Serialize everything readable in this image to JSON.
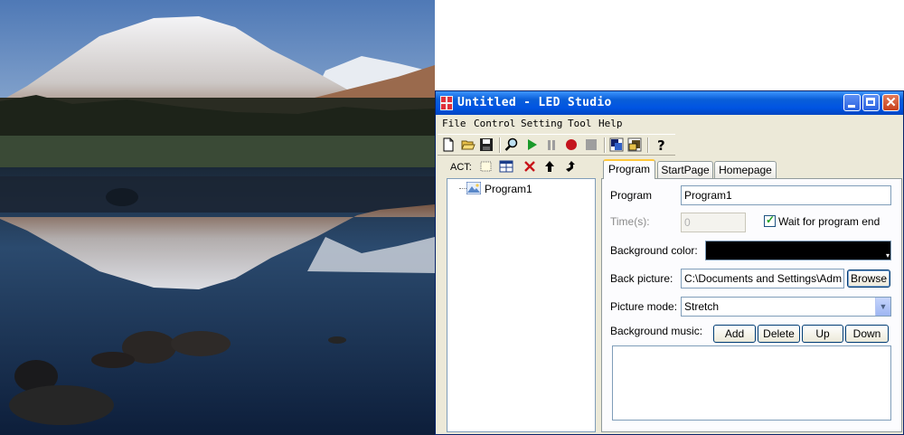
{
  "window": {
    "title": "Untitled - LED Studio"
  },
  "menu": [
    {
      "label": "File"
    },
    {
      "label": "Control"
    },
    {
      "label": "Setting"
    },
    {
      "label": "Tool"
    },
    {
      "label": "Help"
    }
  ],
  "toolbar_icons": [
    "new-file-icon",
    "open-folder-icon",
    "save-icon",
    "search-icon",
    "play-icon",
    "pause-icon",
    "record-icon",
    "stop-icon",
    "window-icon",
    "window-stack-icon",
    "help-icon"
  ],
  "left_panel": {
    "act_label": "ACT:",
    "tree": {
      "items": [
        {
          "label": "Program1"
        }
      ]
    }
  },
  "tabs": [
    {
      "label": "Program",
      "active": true
    },
    {
      "label": "StartPage",
      "active": false
    },
    {
      "label": "Homepage",
      "active": false
    }
  ],
  "form": {
    "program_label": "Program",
    "program_value": "Program1",
    "time_label": "Time(s):",
    "time_value": "0",
    "wait_label": "Wait for program end",
    "wait_checked": true,
    "bgcolor_label": "Background color:",
    "bgcolor_value": "#000000",
    "backpic_label": "Back picture:",
    "backpic_value": "C:\\Documents and Settings\\Adm",
    "browse_label": "Browse",
    "picmode_label": "Picture mode:",
    "picmode_value": "Stretch",
    "bgmusic_label": "Background music:",
    "add_label": "Add",
    "delete_label": "Delete",
    "up_label": "Up",
    "down_label": "Down"
  },
  "colors": {
    "titlebar": "#0054e3",
    "window_bg": "#ece9d8",
    "tab_accent": "#ffc83c"
  }
}
